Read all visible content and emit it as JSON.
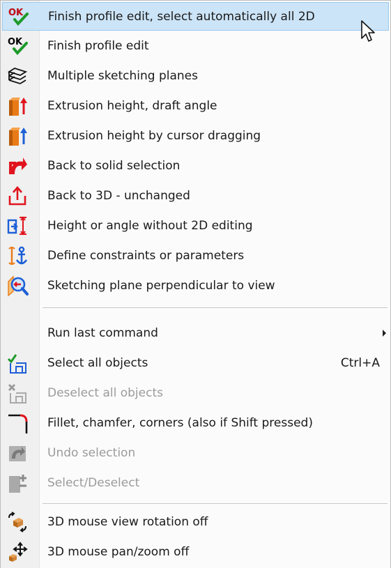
{
  "menu": {
    "items": [
      {
        "label": "Finish profile edit, select automatically all 2D",
        "icon": "ok-check-icon"
      },
      {
        "label": "Finish profile edit",
        "icon": "ok-check-icon"
      },
      {
        "label": "Multiple sketching planes",
        "icon": "stacked-planes-icon"
      },
      {
        "label": "Extrusion height, draft angle",
        "icon": "extrusion-red-arrow-icon"
      },
      {
        "label": "Extrusion height by cursor dragging",
        "icon": "extrusion-blue-arrow-icon"
      },
      {
        "label": "Back to solid selection",
        "icon": "back-arrow-red-icon"
      },
      {
        "label": "Back to 3D - unchanged",
        "icon": "tray-up-arrow-icon"
      },
      {
        "label": "Height or angle without 2D editing",
        "icon": "height-dimension-icon"
      },
      {
        "label": "Define constraints or parameters",
        "icon": "anchor-constraint-icon"
      },
      {
        "label": "Sketching plane perpendicular to view",
        "icon": "view-plane-magnifier-icon"
      },
      {
        "label": "Run last command",
        "icon": ""
      },
      {
        "label": "Select all objects",
        "icon": "select-all-icon",
        "shortcut": "Ctrl+A"
      },
      {
        "label": "Deselect all objects",
        "icon": "deselect-all-icon"
      },
      {
        "label": "Fillet, chamfer, corners (also if Shift pressed)",
        "icon": "fillet-corner-icon"
      },
      {
        "label": "Undo selection",
        "icon": "undo-selection-icon"
      },
      {
        "label": "Select/Deselect",
        "icon": "select-deselect-icon"
      },
      {
        "label": "3D mouse view rotation off",
        "icon": "mouse-rotation-icon"
      },
      {
        "label": "3D mouse pan/zoom off",
        "icon": "mouse-pan-zoom-icon"
      }
    ]
  },
  "colors": {
    "highlight_bg": "#cce4f7",
    "highlight_border": "#99c9ef",
    "disabled_text": "#9b9b9b",
    "ok_black": "#000000",
    "check_green": "#1e9a2a",
    "icon_red": "#e0141e",
    "icon_blue": "#1d5fd6",
    "icon_orange": "#e87a17"
  }
}
